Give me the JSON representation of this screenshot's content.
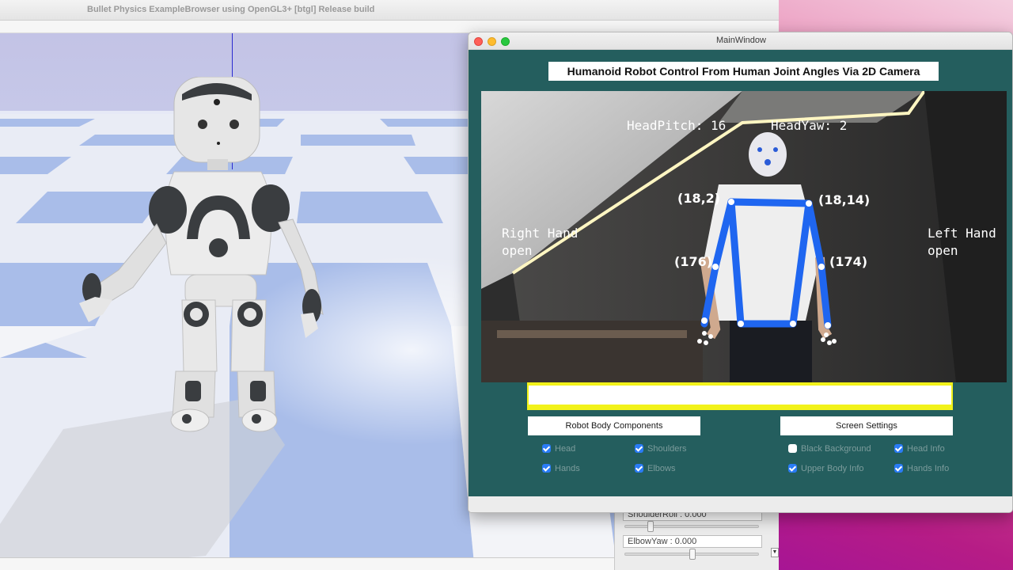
{
  "bullet_window": {
    "title": "Bullet Physics ExampleBrowser using OpenGL3+ [btgl] Release build",
    "params": [
      {
        "label": "ShoulderRoll : 0.000",
        "slider_fraction": 0.2
      },
      {
        "label": "ElbowYaw : 0.000",
        "slider_fraction": 0.5
      }
    ],
    "scroll_arrow": "▼"
  },
  "main_window": {
    "title": "MainWindow",
    "headline": "Humanoid Robot Control From Human Joint Angles Via 2D Camera",
    "camera_overlay": {
      "head_pitch": "HeadPitch: 16",
      "head_yaw": "HeadYaw: 2",
      "right_hand": [
        "Right Hand",
        "open"
      ],
      "left_hand": [
        "Left Hand",
        "open"
      ],
      "shoulder_right": "(18,2)",
      "shoulder_left": "(18,14)",
      "elbow_right": "(176)",
      "elbow_left": "(174)"
    },
    "robot_body_components": {
      "label": "Robot Body Components",
      "options": [
        {
          "label": "Head",
          "checked": true
        },
        {
          "label": "Shoulders",
          "checked": true
        },
        {
          "label": "Hands",
          "checked": true
        },
        {
          "label": "Elbows",
          "checked": true
        }
      ]
    },
    "screen_settings": {
      "label": "Screen Settings",
      "options": [
        {
          "label": "Black Background",
          "checked": false
        },
        {
          "label": "Head Info",
          "checked": true
        },
        {
          "label": "Upper Body Info",
          "checked": true
        },
        {
          "label": "Hands Info",
          "checked": true
        }
      ]
    },
    "accent_color": "#245e5e",
    "skeleton_color": "#1f66f0"
  }
}
